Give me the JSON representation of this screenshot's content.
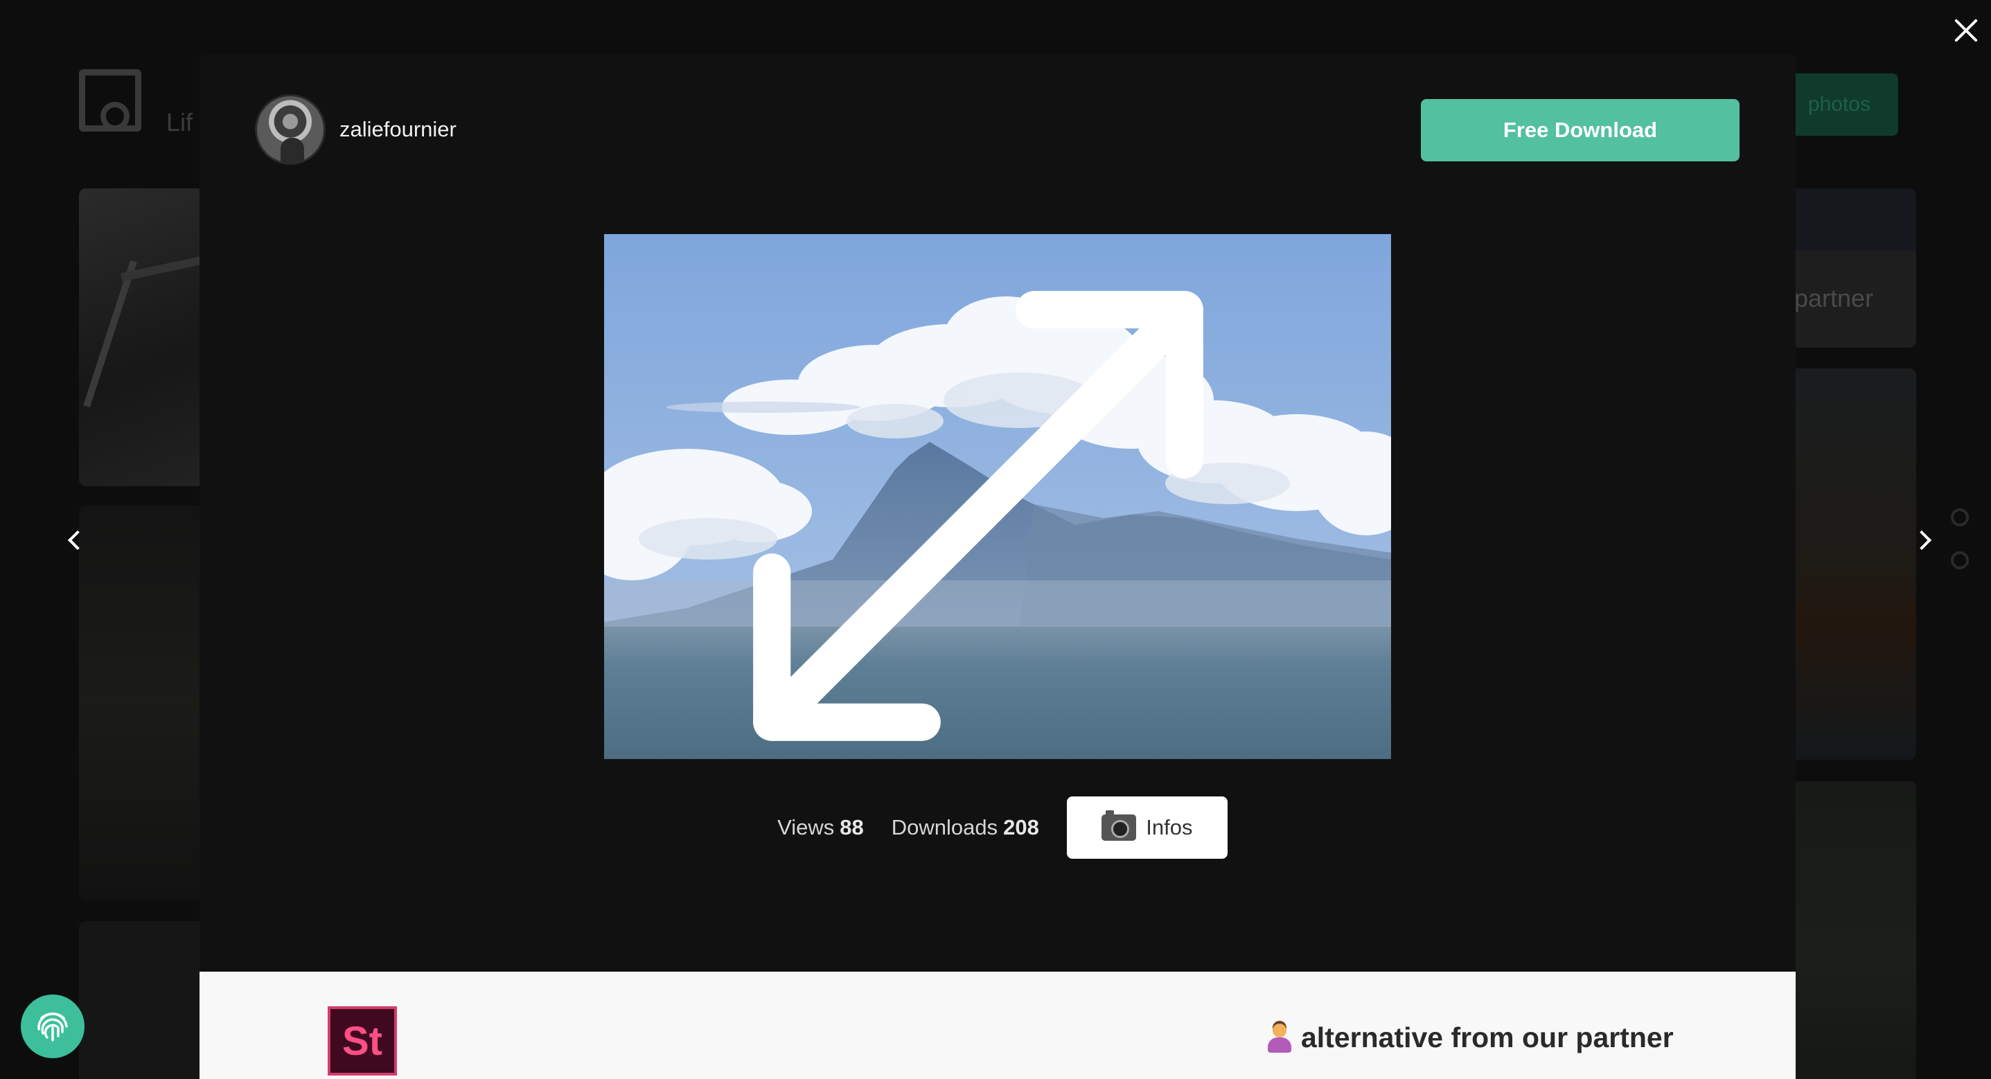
{
  "background": {
    "logo_text": "Lif",
    "photos_button_label": "photos",
    "partner_label": "partner"
  },
  "modal": {
    "author": {
      "username": "zaliefournier"
    },
    "free_download_label": "Free Download",
    "photo": {
      "description": "Volcano partially covered by clouds above a lake",
      "expand_icon": "expand-icon"
    },
    "stats": {
      "views_label": "Views",
      "views_value": "88",
      "downloads_label": "Downloads",
      "downloads_value": "208",
      "infos_label": "Infos",
      "infos_icon": "camera-icon"
    },
    "partner": {
      "logo_text": "St",
      "text": "alternative from our partner",
      "icon": "person-tipping-hand-icon"
    }
  },
  "controls": {
    "close_icon": "close-icon",
    "prev_icon": "chevron-left-icon",
    "next_icon": "chevron-right-icon",
    "fingerprint_icon": "fingerprint-icon"
  },
  "colors": {
    "accent": "#53c0a0",
    "modal_bg": "#111111",
    "partner_bg": "#f8f8f8",
    "stock_logo_bg": "#3f0a1f",
    "stock_logo_fg": "#ff4f86"
  }
}
